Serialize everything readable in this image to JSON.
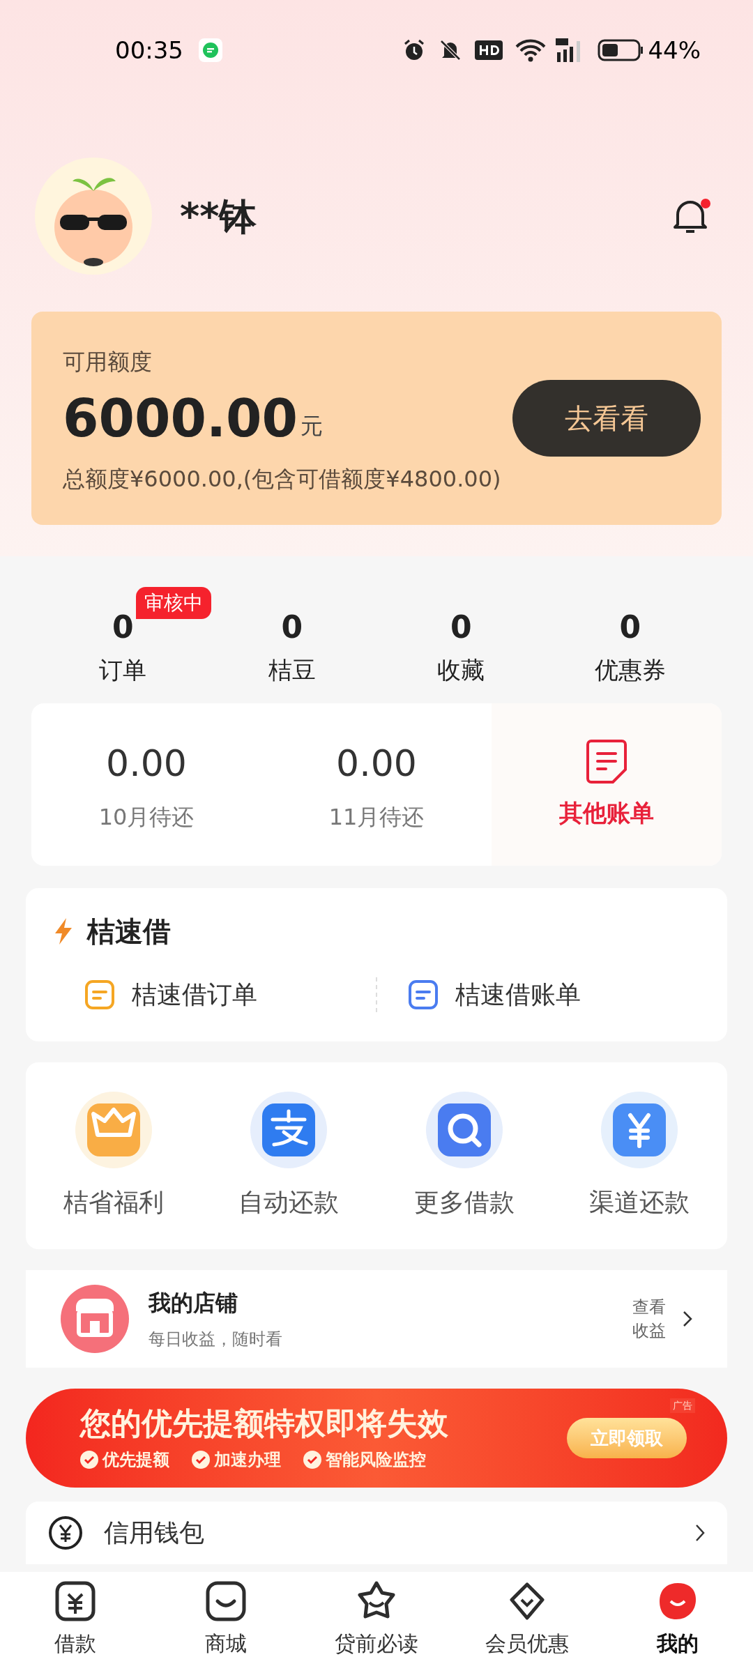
{
  "status_bar": {
    "time": "00:35",
    "battery_level": "44%"
  },
  "profile": {
    "name": "**钵",
    "notification_dot": true
  },
  "credit": {
    "label": "可用额度",
    "amount": "6000.00",
    "unit": "元",
    "button": "去看看",
    "summary": "总额度¥6000.00,(包含可借额度¥4800.00)"
  },
  "stats": [
    {
      "value": "0",
      "label": "订单",
      "badge": "审核中"
    },
    {
      "value": "0",
      "label": "桔豆"
    },
    {
      "value": "0",
      "label": "收藏"
    },
    {
      "value": "0",
      "label": "优惠券"
    }
  ],
  "bills": [
    {
      "kind": "amount",
      "value": "0.00",
      "label": "10月待还"
    },
    {
      "kind": "amount",
      "value": "0.00",
      "label": "11月待还"
    },
    {
      "kind": "link",
      "label": "其他账单"
    }
  ],
  "quick_loan": {
    "title": "桔速借",
    "items": [
      {
        "label": "桔速借订单",
        "color": "#f5a623"
      },
      {
        "label": "桔速借账单",
        "color": "#4a7cf0"
      }
    ]
  },
  "services": [
    {
      "kind": "crown",
      "label": "桔省福利"
    },
    {
      "kind": "pay",
      "label": "自动还款"
    },
    {
      "kind": "search",
      "label": "更多借款"
    },
    {
      "kind": "yen",
      "label": "渠道还款"
    }
  ],
  "store": {
    "title": "我的店铺",
    "subtitle": "每日收益，随时看",
    "link_lines": [
      "查看",
      "收益"
    ]
  },
  "banner": {
    "tag": "广告",
    "headline": "您的优先提额特权即将失效",
    "features": [
      "优先提额",
      "加速办理",
      "智能风险监控"
    ],
    "button": "立即领取"
  },
  "wallet": {
    "title": "信用钱包"
  },
  "tab_bar": [
    {
      "kind": "loan",
      "label": "借款",
      "selected": false
    },
    {
      "kind": "shop",
      "label": "商城",
      "selected": false
    },
    {
      "kind": "star",
      "label": "贷前必读",
      "selected": false
    },
    {
      "kind": "vip",
      "label": "会员优惠",
      "selected": false
    },
    {
      "kind": "mine",
      "label": "我的",
      "selected": true
    }
  ]
}
